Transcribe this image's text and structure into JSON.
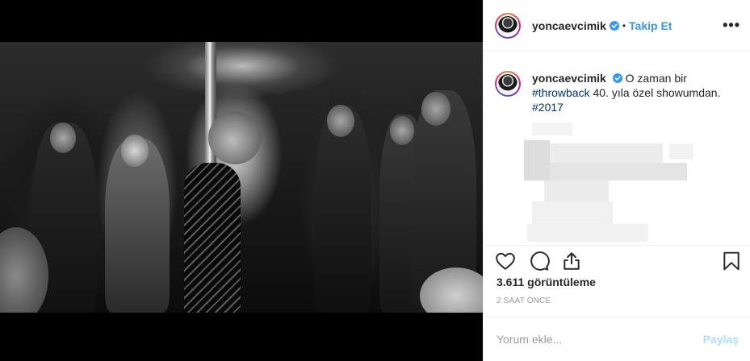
{
  "post": {
    "username": "yoncaevcimik",
    "follow_label": "Takip Et",
    "separator": "•",
    "more_label": "•••",
    "caption": {
      "username": "yoncaevcimik",
      "text_1": "O zaman bir",
      "hashtag_1": "#throwback",
      "text_2": "40. yıla özel showumdan.",
      "hashtag_2": "#2017"
    },
    "views": "3.611 görüntüleme",
    "time": "2 SAAT ÖNCE"
  },
  "comment_box": {
    "placeholder": "Yorum ekle...",
    "post_label": "Paylaş"
  },
  "icons": {
    "verified": "verified-badge-icon",
    "like": "heart-icon",
    "comment": "comment-bubble-icon",
    "share": "share-icon",
    "save": "bookmark-icon",
    "more": "more-options-icon"
  },
  "colors": {
    "accent": "#3897f0",
    "hashtag": "#003569",
    "muted": "#999999",
    "post_disabled": "#b2dffc"
  }
}
